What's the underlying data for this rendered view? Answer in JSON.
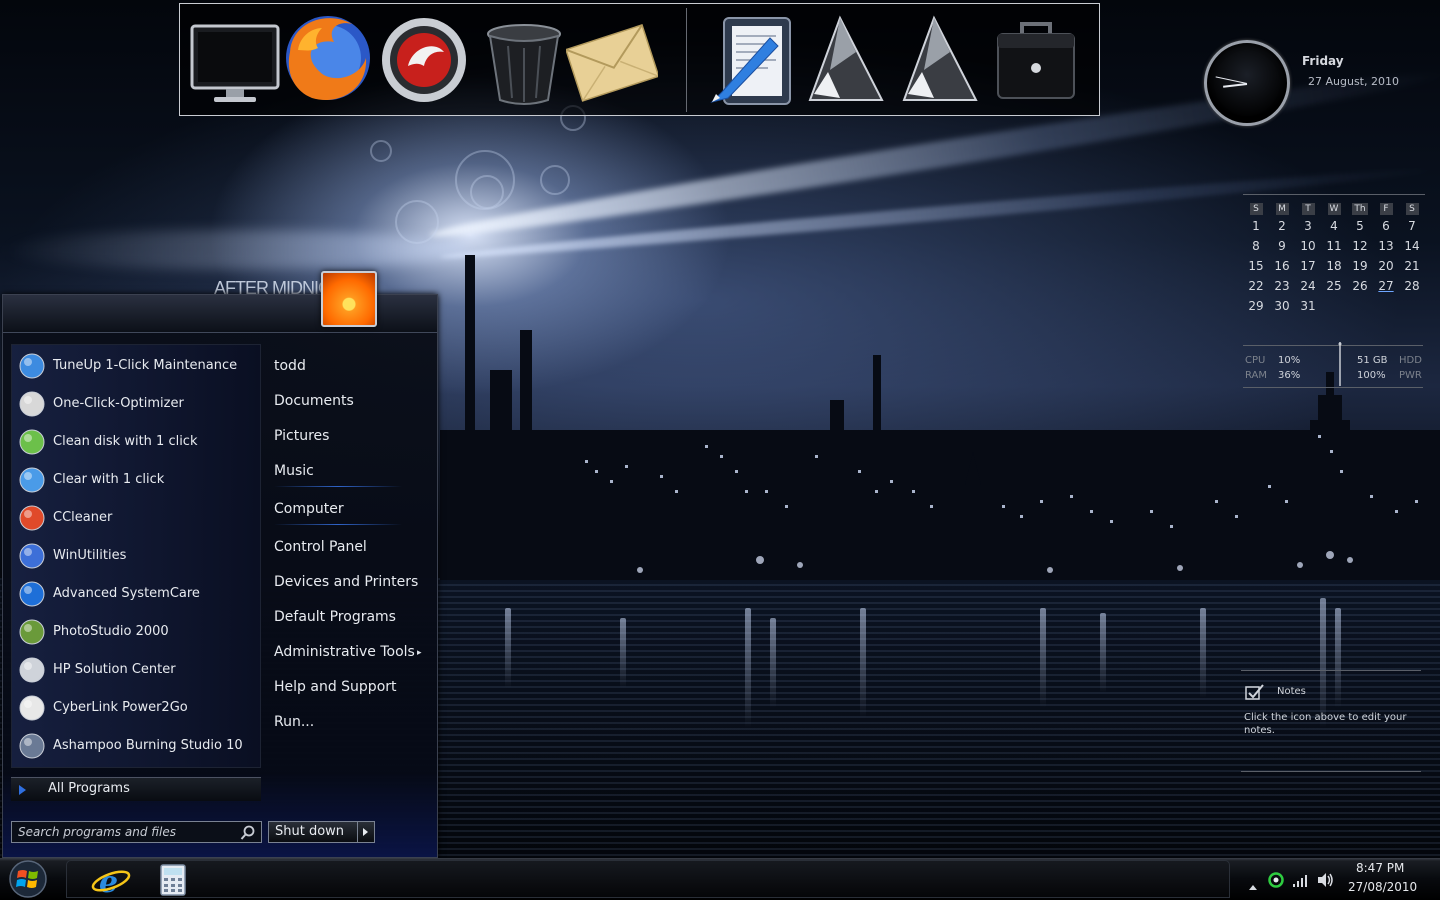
{
  "wallpaper": {
    "title": "AFTER MIDNIGHT"
  },
  "dock": {
    "items": [
      {
        "name": "Computer",
        "icon": "monitor-icon"
      },
      {
        "name": "Firefox",
        "icon": "firefox-icon"
      },
      {
        "name": "Comodo Dragon",
        "icon": "comodo-dragon-icon"
      },
      {
        "name": "Recycle Bin",
        "icon": "recycle-bin-icon"
      },
      {
        "name": "Mail",
        "icon": "mail-envelope-icon"
      },
      {
        "name": "Notepad",
        "icon": "notepad-pen-icon"
      },
      {
        "name": "Shortcut 1",
        "icon": "glass-shard-icon"
      },
      {
        "name": "Shortcut 2",
        "icon": "glass-shard-icon"
      },
      {
        "name": "Briefcase",
        "icon": "briefcase-icon"
      }
    ]
  },
  "clock": {
    "day": "Friday",
    "date": "27 August, 2010",
    "time_hours": 20,
    "time_minutes": 47
  },
  "calendar": {
    "headers": [
      "S",
      "M",
      "T",
      "W",
      "Th",
      "F",
      "S"
    ],
    "days": [
      [
        "1",
        "2",
        "3",
        "4",
        "5",
        "6",
        "7"
      ],
      [
        "8",
        "9",
        "10",
        "11",
        "12",
        "13",
        "14"
      ],
      [
        "15",
        "16",
        "17",
        "18",
        "19",
        "20",
        "21"
      ],
      [
        "22",
        "23",
        "24",
        "25",
        "26",
        "27",
        "28"
      ],
      [
        "29",
        "30",
        "31",
        "",
        "",
        "",
        ""
      ]
    ],
    "today": "27"
  },
  "meter": {
    "cpu_label": "CPU",
    "cpu_value": "10%",
    "ram_label": "RAM",
    "ram_value": "36%",
    "hdd_label": "HDD",
    "hdd_value": "51 GB",
    "pwr_label": "PWR",
    "pwr_value": "100%"
  },
  "notes": {
    "title": "Notes",
    "body": "Click the icon above to edit your notes."
  },
  "start_menu": {
    "programs": [
      {
        "label": "TuneUp 1-Click Maintenance",
        "icon": "tuneup-icon"
      },
      {
        "label": "One-Click-Optimizer",
        "icon": "optimizer-icon"
      },
      {
        "label": "Clean disk with 1 click",
        "icon": "clean-disk-icon"
      },
      {
        "label": "Clear with 1 click",
        "icon": "clear-icon"
      },
      {
        "label": "CCleaner",
        "icon": "ccleaner-icon"
      },
      {
        "label": "WinUtilities",
        "icon": "winutilities-icon"
      },
      {
        "label": "Advanced SystemCare",
        "icon": "advanced-systemcare-icon"
      },
      {
        "label": "PhotoStudio 2000",
        "icon": "photostudio-icon"
      },
      {
        "label": "HP Solution Center",
        "icon": "hp-icon"
      },
      {
        "label": "CyberLink Power2Go",
        "icon": "power2go-icon"
      },
      {
        "label": "Ashampoo Burning Studio 10",
        "icon": "ashampoo-icon"
      }
    ],
    "all_programs": "All Programs",
    "places": [
      {
        "label": "todd"
      },
      {
        "label": "Documents"
      },
      {
        "label": "Pictures"
      },
      {
        "label": "Music"
      },
      {
        "label": "Computer"
      },
      {
        "label": "Control Panel"
      },
      {
        "label": "Devices and Printers"
      },
      {
        "label": "Default Programs"
      },
      {
        "label": "Administrative Tools",
        "submenu": true
      },
      {
        "label": "Help and Support"
      },
      {
        "label": "Run..."
      }
    ],
    "search_placeholder": "Search programs and files",
    "shutdown_label": "Shut down"
  },
  "taskbar": {
    "start_icon": "windows-orb-icon",
    "pinned": [
      {
        "name": "Internet Explorer",
        "icon": "internet-explorer-icon"
      },
      {
        "name": "Calculator",
        "icon": "calculator-icon"
      }
    ],
    "tray": {
      "time": "8:47 PM",
      "date": "27/08/2010"
    }
  },
  "colors": {
    "accent": "#2f6fe0",
    "menu_bg": "#0a0e18",
    "text": "#e8ebf0"
  }
}
